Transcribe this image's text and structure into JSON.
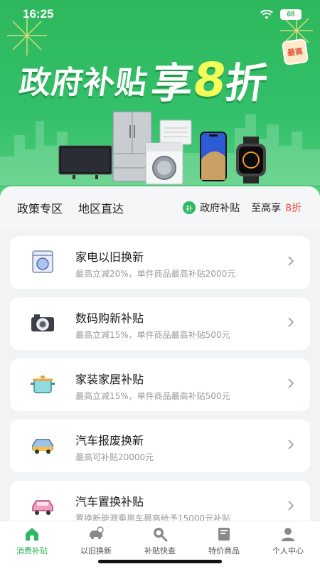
{
  "status": {
    "time": "16:25",
    "battery": "68"
  },
  "banner": {
    "headline_part1": "政府补贴",
    "headline_part2": "享",
    "headline_part3": "8",
    "headline_part4": "折",
    "badge": "最高"
  },
  "policy": {
    "tab1": "政策专区",
    "tab2": "地区直达",
    "bu_icon": "补",
    "gov_label": "政府补贴",
    "max_label": "至高享",
    "discount": "8折"
  },
  "cards": [
    {
      "title": "家电以旧换新",
      "sub": "最高立减20%，单件商品最高补贴2000元",
      "icon": "washer-icon"
    },
    {
      "title": "数码购新补贴",
      "sub": "最高立减15%，单件商品最高补贴500元",
      "icon": "camera-icon"
    },
    {
      "title": "家装家居补贴",
      "sub": "最高立减15%，单件商品最高补贴500元",
      "icon": "pot-icon"
    },
    {
      "title": "汽车报废换新",
      "sub": "最高可补贴20000元",
      "icon": "car-icon"
    },
    {
      "title": "汽车置换补贴",
      "sub": "置换新能源乘用车最高给予15000元补贴",
      "icon": "pink-car-icon"
    }
  ],
  "tabbar": [
    {
      "label": "消费补贴",
      "icon": "home-icon"
    },
    {
      "label": "以旧换新",
      "icon": "car-swap-icon"
    },
    {
      "label": "补贴快查",
      "icon": "search-icon"
    },
    {
      "label": "特价商品",
      "icon": "book-icon"
    },
    {
      "label": "个人中心",
      "icon": "user-icon"
    }
  ],
  "colors": {
    "brand_green": "#2fb862",
    "accent_red": "#e2473a",
    "headline_yellow": "#f2ff58"
  }
}
